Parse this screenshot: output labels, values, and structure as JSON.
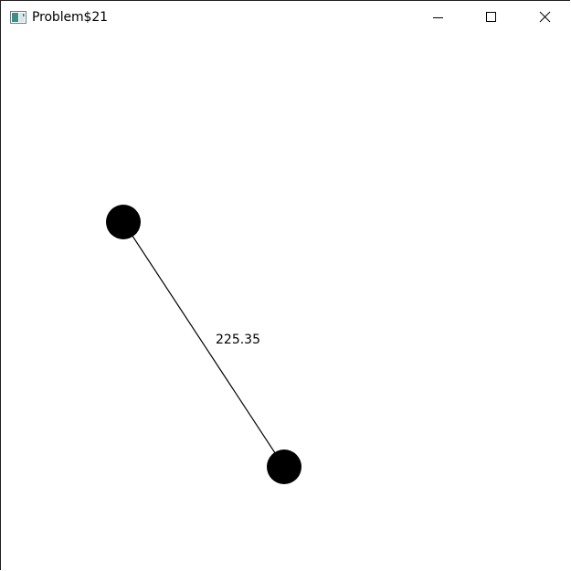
{
  "window": {
    "title": "Problem$21",
    "icon": "app-window-icon",
    "controls": {
      "minimize_icon": "minimize-icon",
      "maximize_icon": "maximize-icon",
      "close_icon": "close-icon"
    }
  },
  "graph": {
    "edge_label": "225.35",
    "node_color": "#000000",
    "edge_color": "#000000"
  }
}
